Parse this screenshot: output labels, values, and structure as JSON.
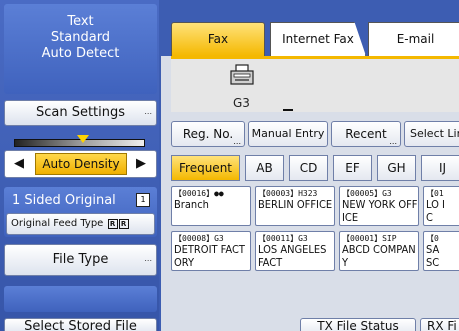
{
  "left": {
    "scan_mode_lines": [
      "Text",
      "Standard",
      "Auto Detect"
    ],
    "scan_settings_label": "Scan Settings",
    "density_left_arrow": "◀",
    "density_label": "Auto Density",
    "density_right_arrow": "▶",
    "sided_label": "1 Sided Original",
    "feed_type_label": "Original Feed Type",
    "feed_icons": [
      "R",
      "R"
    ],
    "file_type_label": "File Type",
    "select_stored_label": "Select Stored File"
  },
  "tabs": [
    {
      "label": "Fax",
      "active": true
    },
    {
      "label": "Internet Fax",
      "active": false
    },
    {
      "label": "E-mail",
      "active": false
    }
  ],
  "display": {
    "mode": "G3",
    "icon": "fax-machine-icon"
  },
  "dest_buttons": [
    {
      "label": "Reg. No."
    },
    {
      "label": "Manual Entry"
    },
    {
      "label": "Recent"
    },
    {
      "label": "Select Lin"
    }
  ],
  "title_tabs": [
    {
      "label": "Frequent",
      "active": true
    },
    {
      "label": "AB"
    },
    {
      "label": "CD"
    },
    {
      "label": "EF"
    },
    {
      "label": "GH"
    },
    {
      "label": "IJ"
    }
  ],
  "destinations": [
    {
      "code": "【00016】",
      "type": "",
      "name": "Branch",
      "group_icon": true
    },
    {
      "code": "【00003】",
      "type": "H323",
      "name": "BERLIN OFFICE"
    },
    {
      "code": "【00005】",
      "type": "G3",
      "name": "NEW YORK OFFICE"
    },
    {
      "code": "【01",
      "type": "",
      "name": "LO IC"
    },
    {
      "code": "【00008】",
      "type": "G3",
      "name": "DETROIT FACTORY"
    },
    {
      "code": "【00011】",
      "type": "G3",
      "name": "LOS ANGELES FACT"
    },
    {
      "code": "【00001】",
      "type": "SIP",
      "name": "ABCD COMPANY"
    },
    {
      "code": "【0",
      "type": "",
      "name": "SA SC"
    }
  ],
  "status_buttons": [
    {
      "label": "TX File Status"
    },
    {
      "label": "RX Fi"
    }
  ],
  "colors": {
    "accent": "#f4b800",
    "background": "#3d5db2",
    "panel": "#d9dee8"
  }
}
